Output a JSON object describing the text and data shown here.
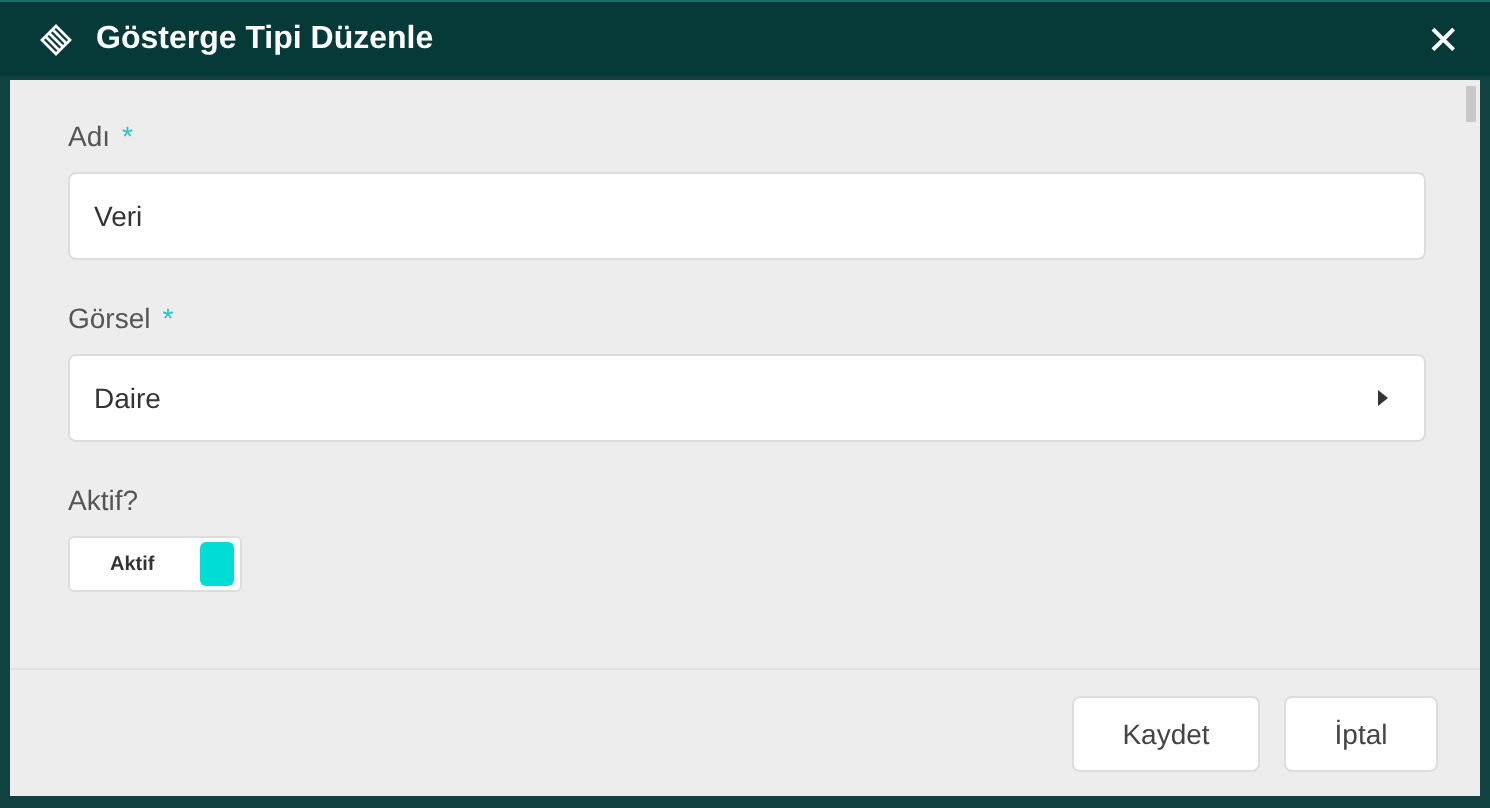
{
  "window": {
    "title": "Gösterge Tipi Düzenle",
    "close": "✕"
  },
  "fields": [
    {
      "kind": "text",
      "label": "Adı",
      "required_mark": "*",
      "value": "Veri"
    },
    {
      "kind": "select",
      "label": "Görsel",
      "required_mark": "*",
      "value": "Daire"
    },
    {
      "kind": "toggle",
      "label": "Aktif?",
      "on": true,
      "text": "Aktif"
    }
  ],
  "buttons": [
    "Kaydet",
    "İptal"
  ]
}
